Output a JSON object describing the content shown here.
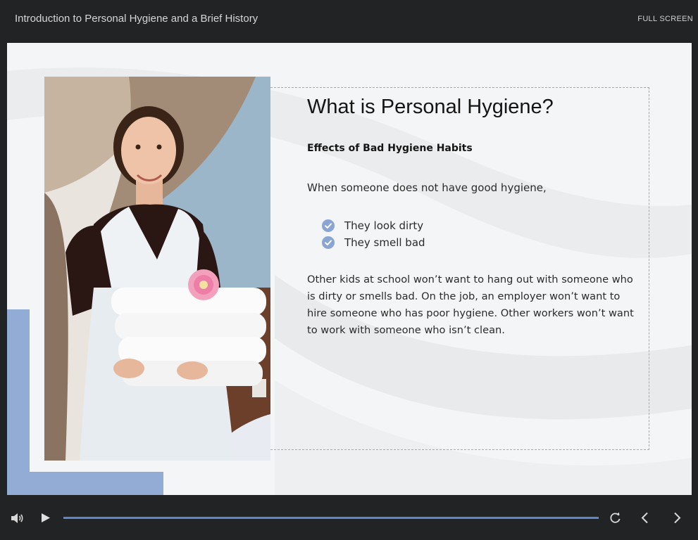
{
  "header": {
    "course_title": "Introduction to Personal Hygiene and a Brief History",
    "fullscreen_label": "FULL SCREEN"
  },
  "slide": {
    "title": "What is Personal Hygiene?",
    "subtitle": "Effects of Bad Hygiene Habits",
    "intro": "When someone does not have good hygiene,",
    "bullets": [
      "They look dirty",
      "They smell bad"
    ],
    "paragraph": "Other kids at school won’t want to hang out with someone who is dirty or smells bad. On the job, an employer won’t want to hire someone who has poor hygiene. Other workers won’t want to work with someone who isn’t clean.",
    "image": {
      "subject": "smiling housekeeper holding a stack of white towels with a pink flower"
    }
  },
  "player": {
    "progress": 1.0
  },
  "icons": {
    "volume": "volume-icon",
    "play": "play-icon",
    "replay": "replay-icon",
    "previous": "chevron-left-icon",
    "next": "chevron-right-icon",
    "bullet": "check-circle-icon"
  },
  "colors": {
    "chrome": "#222325",
    "accent": "#93acd6",
    "progress": "#5d88c9",
    "check": "#8aa5d4",
    "slide_background": "#f4f5f6"
  }
}
